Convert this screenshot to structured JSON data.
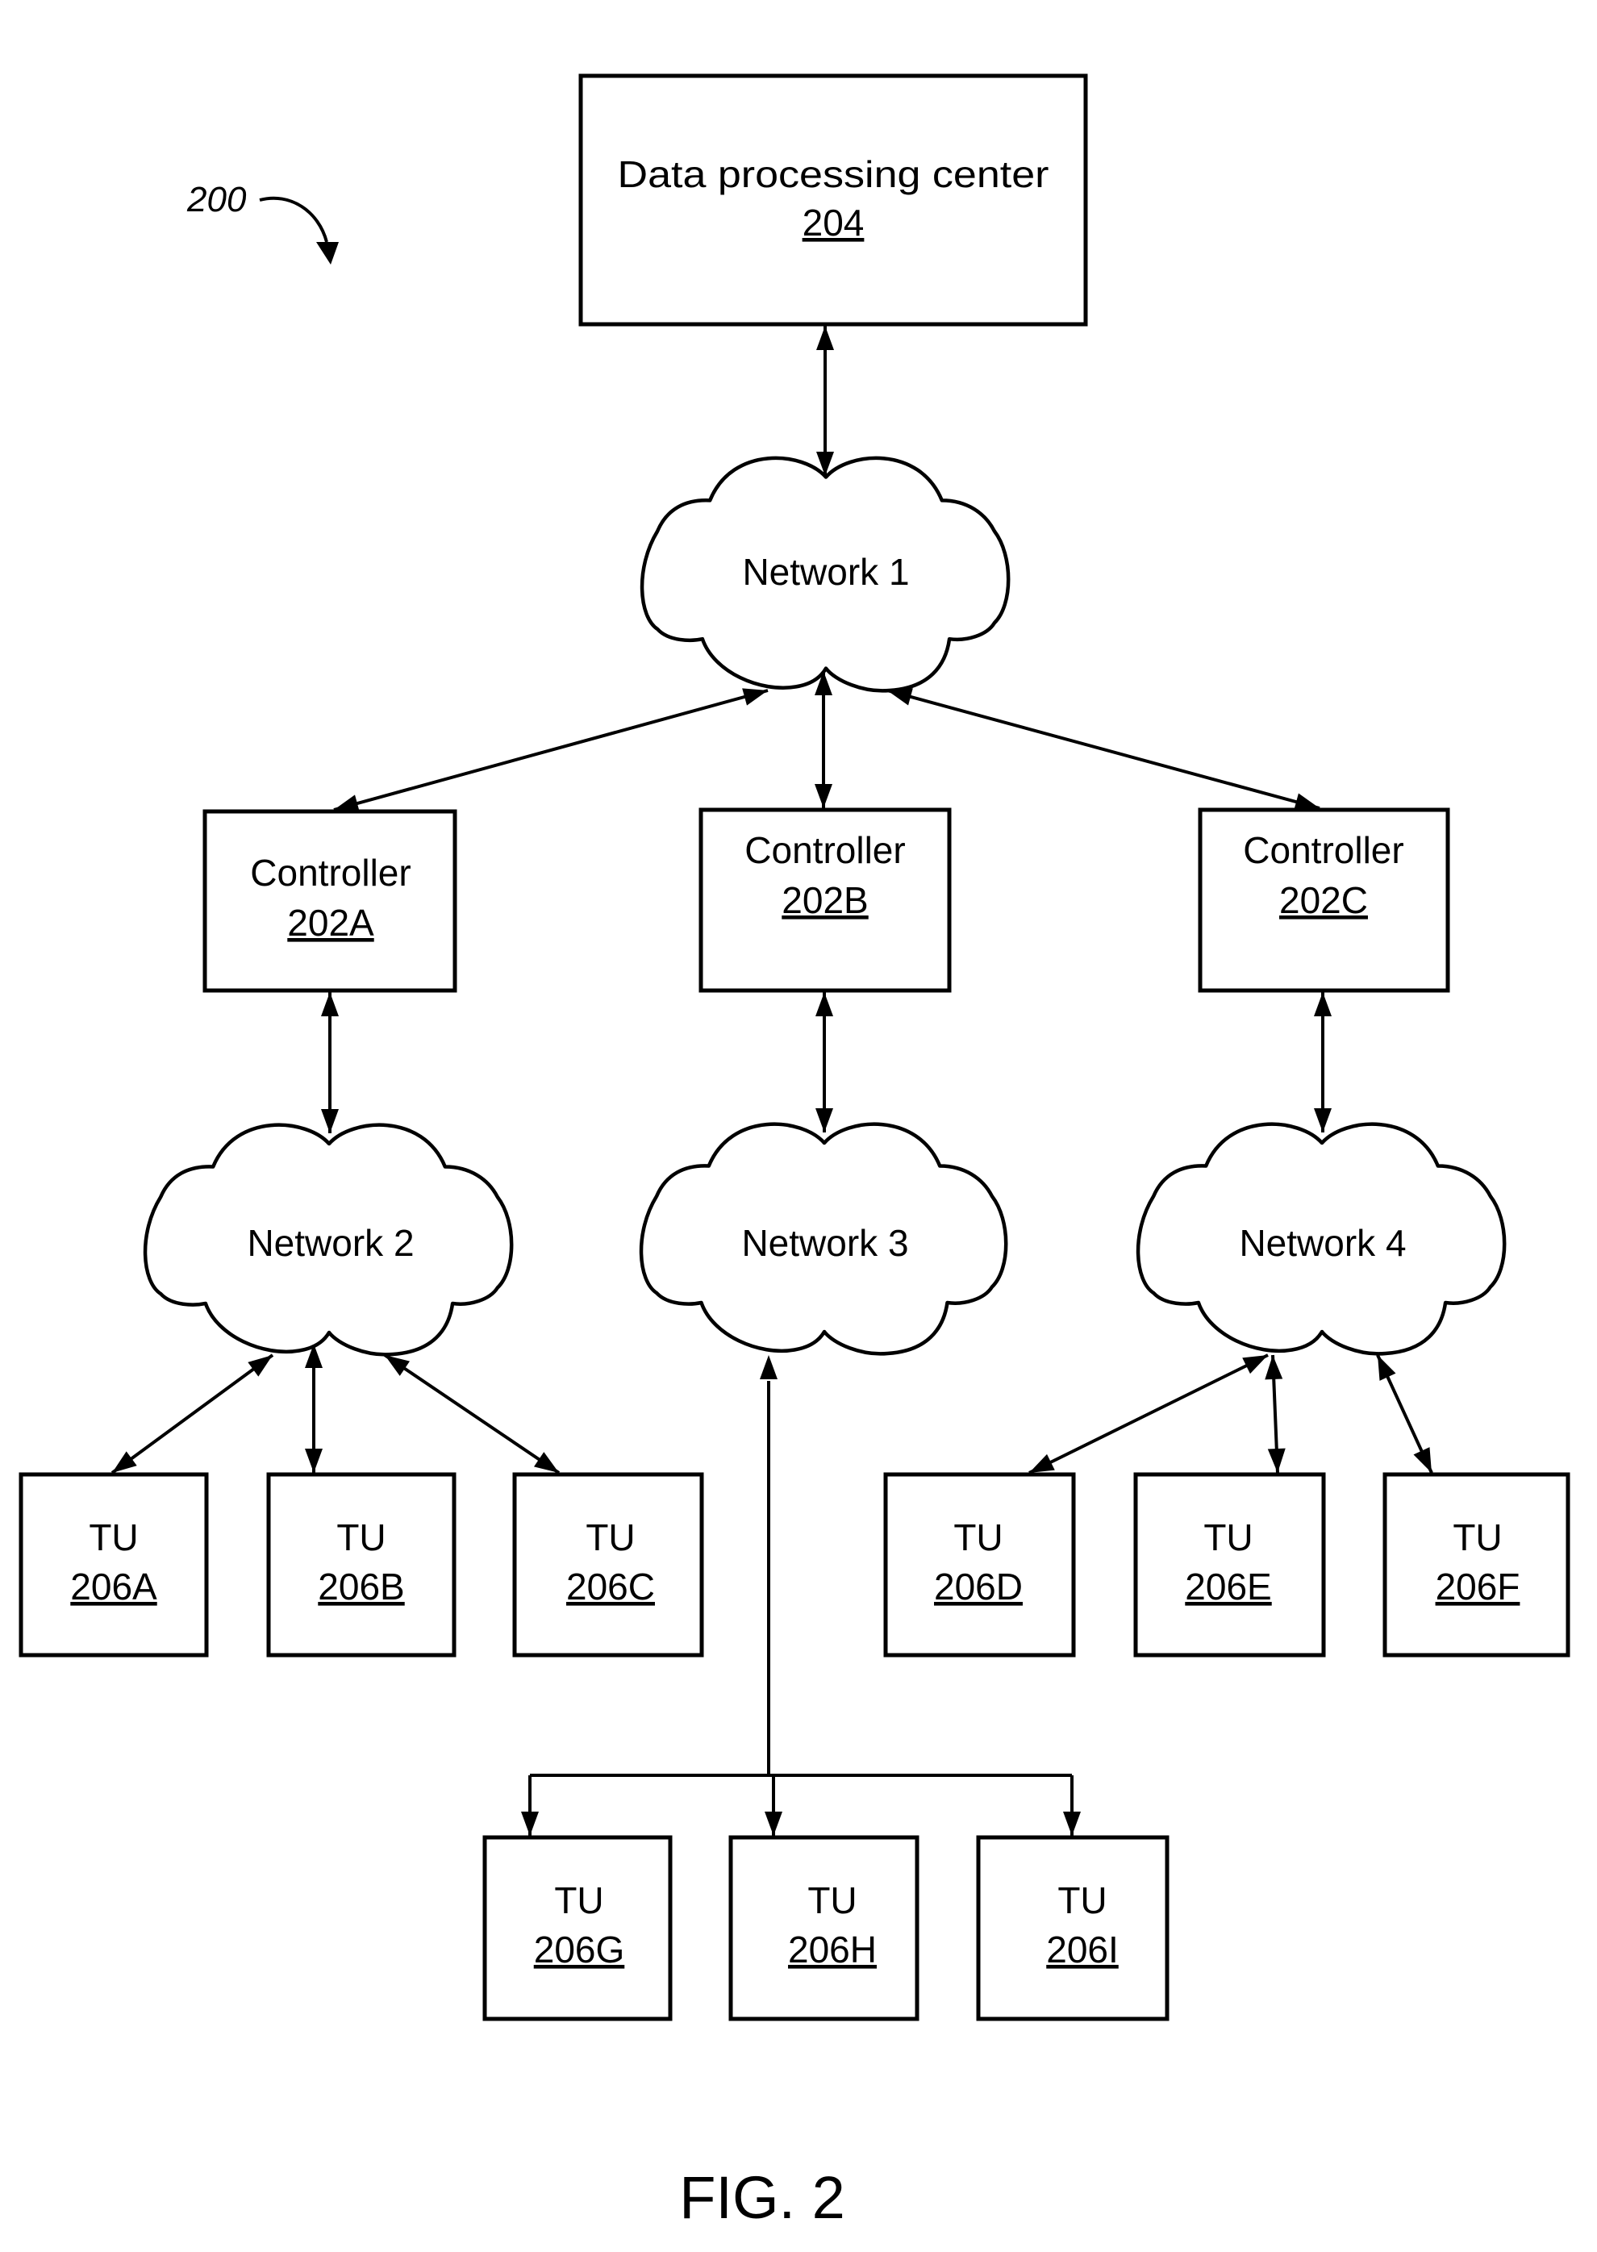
{
  "figure": {
    "reference_numeral": "200",
    "caption": "FIG. 2"
  },
  "data_center": {
    "label": "Data processing center",
    "ref": "204"
  },
  "networks": [
    {
      "id": "n1",
      "label": "Network 1"
    },
    {
      "id": "n2",
      "label": "Network 2"
    },
    {
      "id": "n3",
      "label": "Network 3"
    },
    {
      "id": "n4",
      "label": "Network 4"
    }
  ],
  "controllers": [
    {
      "id": "c1",
      "label": "Controller",
      "ref": "202A"
    },
    {
      "id": "c2",
      "label": "Controller",
      "ref": "202B"
    },
    {
      "id": "c3",
      "label": "Controller",
      "ref": "202C"
    }
  ],
  "terminal_units": [
    {
      "id": "tA",
      "label": "TU",
      "ref": "206A"
    },
    {
      "id": "tB",
      "label": "TU",
      "ref": "206B"
    },
    {
      "id": "tC",
      "label": "TU",
      "ref": "206C"
    },
    {
      "id": "tD",
      "label": "TU",
      "ref": "206D"
    },
    {
      "id": "tE",
      "label": "TU",
      "ref": "206E"
    },
    {
      "id": "tF",
      "label": "TU",
      "ref": "206F"
    },
    {
      "id": "tG",
      "label": "TU",
      "ref": "206G"
    },
    {
      "id": "tH",
      "label": "TU",
      "ref": "206H"
    },
    {
      "id": "tI",
      "label": "TU",
      "ref": "206I"
    }
  ],
  "connections": [
    {
      "from": "Data processing center",
      "to": "Network 1",
      "type": "bidirectional"
    },
    {
      "from": "Network 1",
      "to": "Controller 202A",
      "type": "bidirectional"
    },
    {
      "from": "Network 1",
      "to": "Controller 202B",
      "type": "bidirectional"
    },
    {
      "from": "Network 1",
      "to": "Controller 202C",
      "type": "bidirectional"
    },
    {
      "from": "Controller 202A",
      "to": "Network 2",
      "type": "bidirectional"
    },
    {
      "from": "Controller 202B",
      "to": "Network 3",
      "type": "bidirectional"
    },
    {
      "from": "Controller 202C",
      "to": "Network 4",
      "type": "bidirectional"
    },
    {
      "from": "Network 2",
      "to": "TU 206A",
      "type": "bidirectional"
    },
    {
      "from": "Network 2",
      "to": "TU 206B",
      "type": "bidirectional"
    },
    {
      "from": "Network 2",
      "to": "TU 206C",
      "type": "bidirectional"
    },
    {
      "from": "Network 4",
      "to": "TU 206D",
      "type": "bidirectional"
    },
    {
      "from": "Network 4",
      "to": "TU 206E",
      "type": "bidirectional"
    },
    {
      "from": "Network 4",
      "to": "TU 206F",
      "type": "bidirectional"
    },
    {
      "from": "Network 3",
      "to": "TU 206G",
      "type": "bus"
    },
    {
      "from": "Network 3",
      "to": "TU 206H",
      "type": "bus"
    },
    {
      "from": "Network 3",
      "to": "TU 206I",
      "type": "bus"
    }
  ]
}
